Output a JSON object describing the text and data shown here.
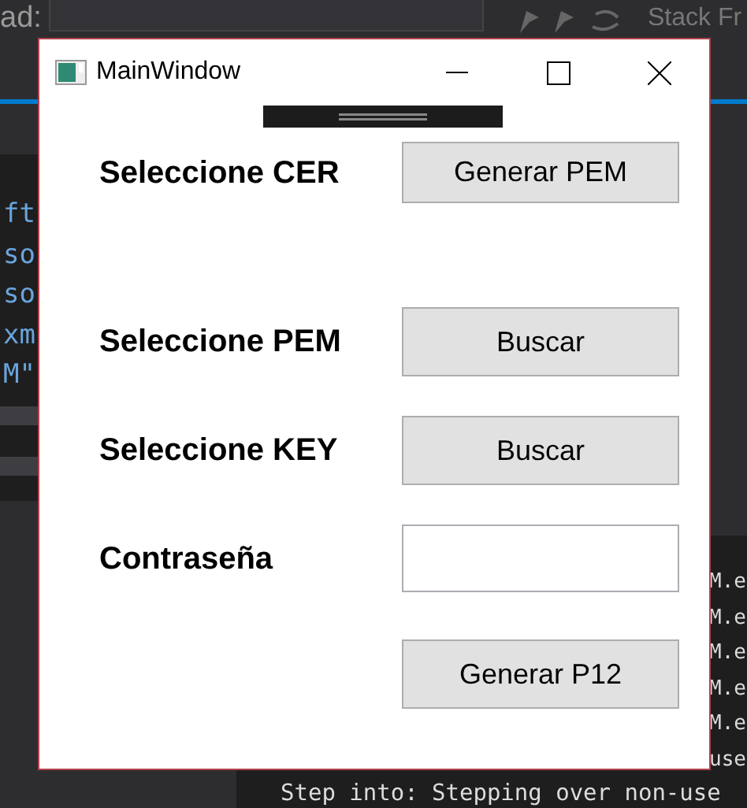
{
  "ide": {
    "toolbar_label": "ad:",
    "stack_frame": "Stack Fr",
    "code_lines": [
      "ft",
      "so",
      "so",
      "xm",
      "M\""
    ],
    "output_lines": [
      "M.e",
      "M.e",
      "M.e",
      "M.e",
      "M.e",
      "use"
    ],
    "output_bottom": "Step into: Stepping over non-use"
  },
  "window": {
    "title": "MainWindow"
  },
  "form": {
    "rows": [
      {
        "kind": "button",
        "label": "Seleccione CER",
        "button": "Generar PEM"
      },
      {
        "kind": "button",
        "label": "Seleccione PEM",
        "button": "Buscar"
      },
      {
        "kind": "button",
        "label": "Seleccione KEY",
        "button": "Buscar"
      },
      {
        "kind": "input",
        "label": "Contraseña"
      },
      {
        "kind": "button",
        "button": "Generar P12"
      }
    ]
  }
}
